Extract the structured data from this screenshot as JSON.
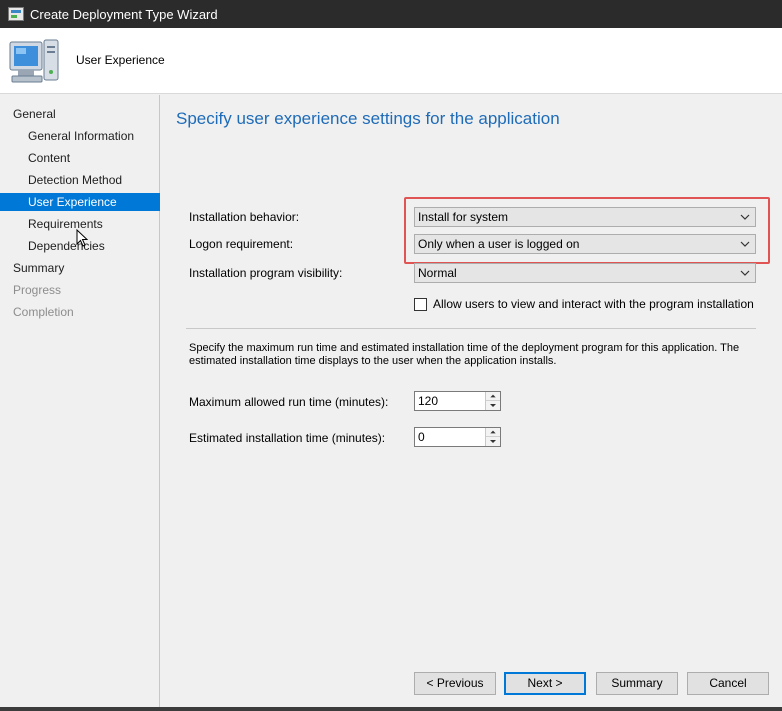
{
  "window": {
    "title": "Create Deployment Type Wizard"
  },
  "header": {
    "title": "User Experience"
  },
  "nav": {
    "items": [
      {
        "label": "General",
        "state": "normal"
      },
      {
        "label": "General Information",
        "state": "normal"
      },
      {
        "label": "Content",
        "state": "normal"
      },
      {
        "label": "Detection Method",
        "state": "normal"
      },
      {
        "label": "User Experience",
        "state": "selected"
      },
      {
        "label": "Requirements",
        "state": "normal"
      },
      {
        "label": "Dependencies",
        "state": "normal"
      },
      {
        "label": "Summary",
        "state": "normal"
      },
      {
        "label": "Progress",
        "state": "disabled"
      },
      {
        "label": "Completion",
        "state": "disabled"
      }
    ]
  },
  "page": {
    "title": "Specify user experience settings for the application",
    "installation_behavior": {
      "label": "Installation behavior:",
      "value": "Install for system"
    },
    "logon_requirement": {
      "label": "Logon requirement:",
      "value": "Only when a user is logged on"
    },
    "program_visibility": {
      "label": "Installation program visibility:",
      "value": "Normal"
    },
    "allow_interact": {
      "label": "Allow users to view and interact with the program installation",
      "checked": false
    },
    "description": "Specify the maximum run time and estimated installation time of the deployment program for this application. The estimated installation time displays to the user when the application installs.",
    "max_run_time": {
      "label": "Maximum allowed run time (minutes):",
      "value": "120"
    },
    "est_install_time": {
      "label": "Estimated installation time (minutes):",
      "value": "0"
    }
  },
  "buttons": {
    "previous": "< Previous",
    "next": "Next >",
    "summary": "Summary",
    "cancel": "Cancel"
  },
  "colors": {
    "accent": "#0078d7",
    "title_text": "#1e6bb8",
    "highlight": "#e05454"
  }
}
